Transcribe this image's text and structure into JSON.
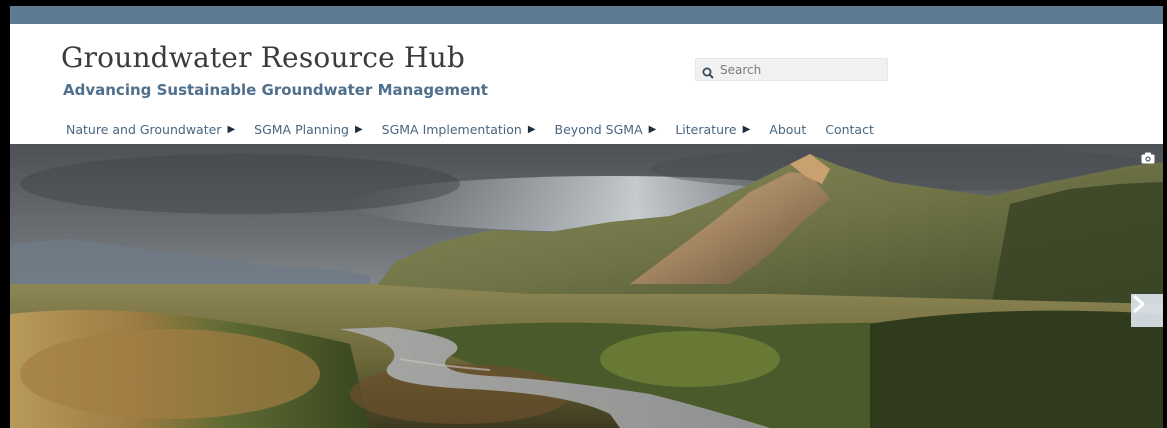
{
  "site": {
    "title": "Groundwater Resource Hub",
    "tagline": "Advancing Sustainable Groundwater Management"
  },
  "search": {
    "placeholder": "Search",
    "icon": "search-icon"
  },
  "nav": {
    "items": [
      {
        "label": "Nature and Groundwater",
        "has_submenu": true
      },
      {
        "label": "SGMA Planning",
        "has_submenu": true
      },
      {
        "label": "SGMA Implementation",
        "has_submenu": true
      },
      {
        "label": "Beyond SGMA",
        "has_submenu": true
      },
      {
        "label": "Literature",
        "has_submenu": true
      },
      {
        "label": "About",
        "has_submenu": false
      },
      {
        "label": "Contact",
        "has_submenu": false
      }
    ],
    "caret": "▶"
  },
  "hero": {
    "icons": [
      "camera-icon",
      "next-arrow-icon"
    ]
  },
  "colors": {
    "topbar": "#5f7b93",
    "title": "#3b3b3b",
    "tagline": "#4f6f8c",
    "nav_text": "#4a6680"
  }
}
